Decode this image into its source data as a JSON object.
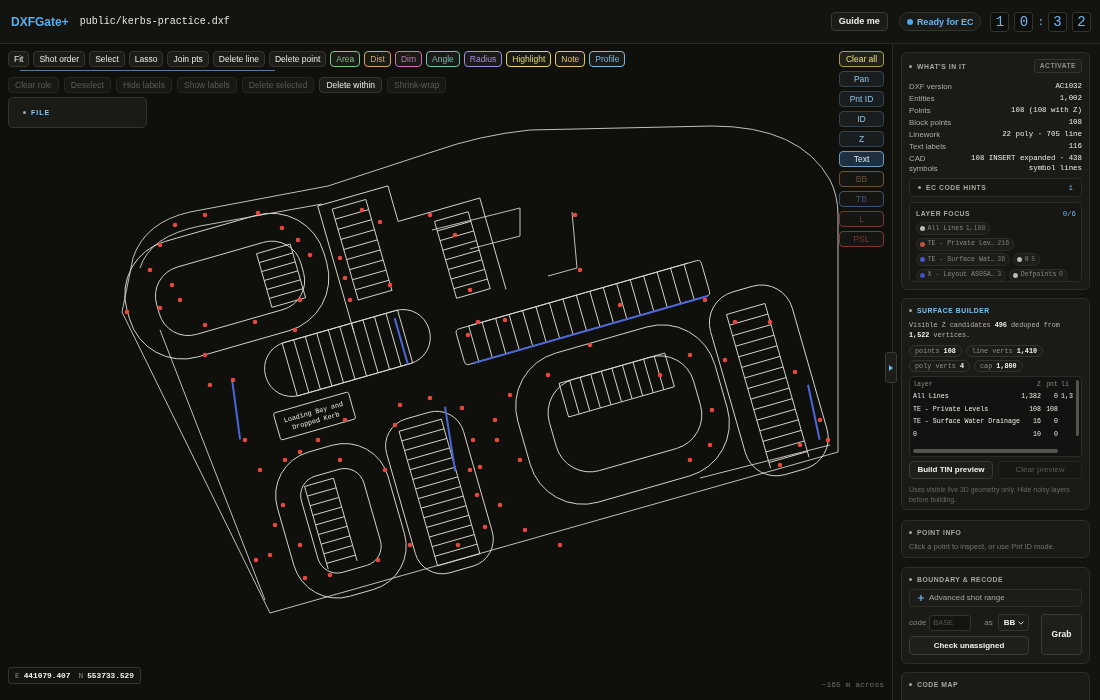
{
  "app": {
    "name": "DXFGate+",
    "file_path": "public/kerbs-practice.dxf"
  },
  "header": {
    "guide_button": "Guide me",
    "status": {
      "label": "Ready for EC",
      "color": "#4da6e8"
    },
    "clock": {
      "digits": [
        "1",
        "0",
        "3",
        "2"
      ],
      "separator": ":"
    }
  },
  "toolbar": {
    "tools": [
      {
        "label": "Fit",
        "kind": "tool"
      },
      {
        "label": "Shot order",
        "kind": "tool"
      },
      {
        "label": "Select",
        "kind": "tool"
      },
      {
        "label": "Lasso",
        "kind": "tool"
      },
      {
        "label": "Join pts",
        "kind": "tool"
      },
      {
        "label": "Delete line",
        "kind": "tool"
      },
      {
        "label": "Delete point",
        "kind": "tool"
      },
      {
        "label": "Area",
        "kind": "measure",
        "color": "#78c88a"
      },
      {
        "label": "Dist",
        "kind": "measure",
        "color": "#dca460"
      },
      {
        "label": "Dim",
        "kind": "measure",
        "color": "#d070b4"
      },
      {
        "label": "Angle",
        "kind": "measure",
        "color": "#6cc4b4"
      },
      {
        "label": "Radius",
        "kind": "measure",
        "color": "#a48ae0"
      },
      {
        "label": "Highlight",
        "kind": "measure",
        "color": "#e4d860"
      },
      {
        "label": "Note",
        "kind": "measure",
        "color": "#e6c46c"
      },
      {
        "label": "Profile",
        "kind": "measure",
        "color": "#7cb8e0"
      }
    ],
    "actions": [
      {
        "label": "Clear role",
        "disabled": true
      },
      {
        "label": "Deselect",
        "disabled": true
      },
      {
        "label": "Hide labels",
        "disabled": true
      },
      {
        "label": "Show labels",
        "disabled": true
      },
      {
        "label": "Delete selected",
        "disabled": true
      },
      {
        "label": "Delete within",
        "disabled": false
      },
      {
        "label": "Shrink-wrap",
        "disabled": true
      }
    ]
  },
  "file_panel": {
    "title": "FILE"
  },
  "view_controls": {
    "clear_button": "Clear all",
    "modes": [
      {
        "label": "Pan",
        "selected": false
      },
      {
        "label": "Pnt ID",
        "selected": false
      },
      {
        "label": "ID",
        "selected": false
      },
      {
        "label": "Z",
        "selected": false
      },
      {
        "label": "Text",
        "selected": true
      }
    ],
    "codes": [
      {
        "label": "BB",
        "color": "#6e5434",
        "disabled": true
      },
      {
        "label": "TB",
        "color": "#3c5478",
        "disabled": true
      },
      {
        "label": "L",
        "color": "#6e3c32",
        "disabled": true
      },
      {
        "label": "PSL",
        "color": "#7e3a30",
        "disabled": true
      }
    ]
  },
  "canvas": {
    "drawing_label": [
      "Loading Bay and",
      "Dropped Kerb"
    ],
    "coordinates": [
      {
        "axis": "E",
        "value": "441079.407"
      },
      {
        "axis": "N",
        "value": "553733.529"
      }
    ],
    "scale": "~165 m across"
  },
  "panel": {
    "whats_in_it": {
      "title": "WHAT'S IN IT",
      "action": "ACTIVATE",
      "rows": [
        {
          "label": "DXF version",
          "value": "AC1032"
        },
        {
          "label": "Entities",
          "value": "1,002"
        },
        {
          "label": "Points",
          "value": "108 (108 with Z)"
        },
        {
          "label": "Block points",
          "value": "108"
        },
        {
          "label": "Linework",
          "value": "22 poly · 705 line"
        },
        {
          "label": "Text labels",
          "value": "116"
        },
        {
          "label": "CAD symbols",
          "value": "108 INSERT expanded · 438 symbol lines"
        }
      ],
      "ec_code_hints": {
        "title": "EC CODE HINTS",
        "count": "1"
      },
      "layer_focus": {
        "title": "LAYER FOCUS",
        "count": "0/6",
        "layers": [
          {
            "name": "All Lines",
            "count": "1,188",
            "color": "#bdbbb2",
            "selected": false
          },
          {
            "name": "TE - Private Lev…",
            "count": "216",
            "color": "#c8503f",
            "selected": false
          },
          {
            "name": "TE - Surface Wat…",
            "count": "36",
            "color": "#4656c8",
            "selected": false
          },
          {
            "name": "0",
            "count": "5",
            "color": "#bdbbb2",
            "selected": false
          },
          {
            "name": "X - Layout AS0SA…",
            "count": "3",
            "color": "#3f4fc0",
            "selected": false
          },
          {
            "name": "Defpoints",
            "count": "0",
            "color": "#bdbbb2",
            "selected": false
          }
        ]
      }
    },
    "surface_builder": {
      "title": "SURFACE BUILDER",
      "summary": "Visible Z candidates **496** deduped from **1,522** vertices.",
      "stats": [
        "points **108**",
        "line verts **1,410**",
        "poly verts **4**",
        "cap **1,800**"
      ],
      "table": {
        "columns": [
          "layer",
          "Z",
          "pnt",
          "li"
        ],
        "rows": [
          [
            "All Lines",
            "1,382",
            "0",
            "1,3"
          ],
          [
            "TE - Private Levels",
            "108",
            "108"
          ],
          [
            "TE - Surface Water Drainage",
            "16",
            "0"
          ],
          [
            "0",
            "10",
            "0"
          ]
        ]
      },
      "buttons": [
        {
          "label": "Build TIN preview",
          "disabled": false
        },
        {
          "label": "Clear preview",
          "disabled": true
        }
      ],
      "note": "Uses visible live 3D geometry only. Hide noisy layers before building."
    },
    "point_info": {
      "title": "POINT INFO",
      "hint": "Click a point to inspect, or use Pnt ID mode."
    },
    "boundary_recode": {
      "title": "BOUNDARY & RECODE",
      "advanced": "Advanced shot range",
      "code_label": "code",
      "code_placeholder": "BASE",
      "as_label": "as",
      "as_value": "BB",
      "check_button": "Check unassigned",
      "grab_button": "Grab"
    },
    "code_map": {
      "title": "CODE MAP"
    }
  }
}
